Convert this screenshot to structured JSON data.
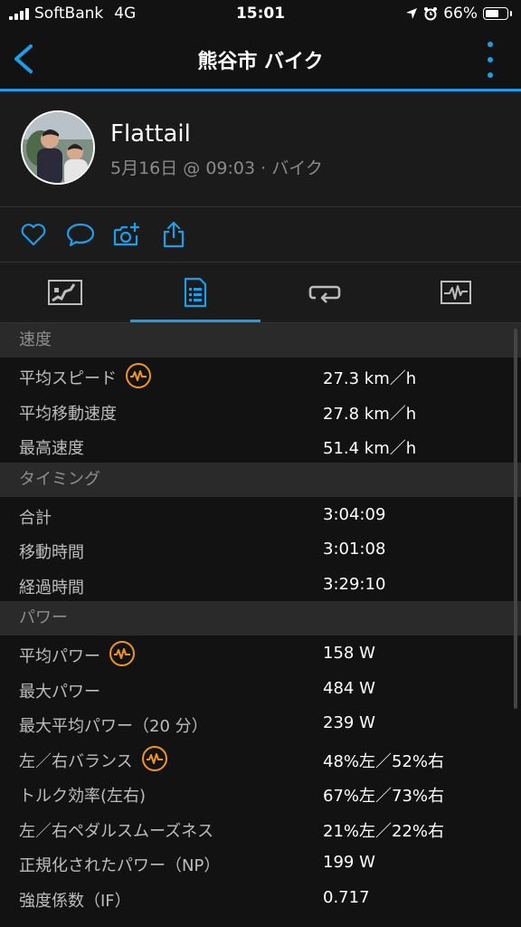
{
  "status": {
    "carrier": "SoftBank",
    "network": "4G",
    "time": "15:01",
    "battery": "66%",
    "battery_level": 0.66
  },
  "nav": {
    "title": "熊谷市 バイク"
  },
  "profile": {
    "name": "Flattail",
    "meta": "5月16日 @ 09:03 · バイク"
  },
  "actions": [
    "heart-icon",
    "comment-icon",
    "camera-add-icon",
    "share-icon"
  ],
  "tabs": [
    "map-tab",
    "stats-tab",
    "laps-tab",
    "chart-tab"
  ],
  "sections": [
    {
      "title": "速度",
      "rows": [
        {
          "label": "平均スピード",
          "value": "27.3 km／h",
          "power_icon": true
        },
        {
          "label": "平均移動速度",
          "value": "27.8 km／h"
        },
        {
          "label": "最高速度",
          "value": "51.4 km／h"
        }
      ]
    },
    {
      "title": "タイミング",
      "rows": [
        {
          "label": "合計",
          "value": "3:04:09"
        },
        {
          "label": "移動時間",
          "value": "3:01:08"
        },
        {
          "label": "経過時間",
          "value": "3:29:10"
        }
      ]
    },
    {
      "title": "パワー",
      "rows": [
        {
          "label": "平均パワー",
          "value": "158 W",
          "power_icon": true
        },
        {
          "label": "最大パワー",
          "value": "484 W"
        },
        {
          "label": "最大平均パワー（20 分）",
          "value": "239 W"
        },
        {
          "label": "左／右バランス",
          "value": "48%左／52%右",
          "power_icon": true
        },
        {
          "label": "トルク効率(左右)",
          "value": "67%左／73%右"
        },
        {
          "label": "左／右ペダルスムーズネス",
          "value": "21%左／22%右"
        },
        {
          "label": "正規化されたパワー（NP）",
          "value": "199 W"
        },
        {
          "label": "強度係数（IF）",
          "value": "0.717"
        }
      ]
    }
  ]
}
